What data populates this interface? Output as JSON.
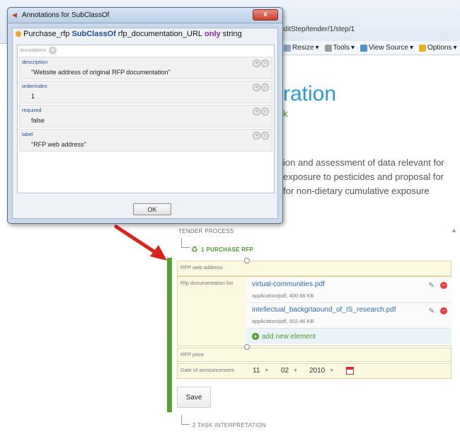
{
  "browser": {
    "url": "editStep/tender/1/step/1",
    "toolbar": [
      {
        "label": "Resize",
        "icon": "resize-icon",
        "arrow": "▾"
      },
      {
        "label": "Tools",
        "icon": "tools-icon",
        "arrow": "▾"
      },
      {
        "label": "View Source",
        "icon": "view-source-icon",
        "arrow": "▾"
      },
      {
        "label": "Options",
        "icon": "options-icon",
        "arrow": "▾"
      }
    ]
  },
  "page": {
    "heading": "ration",
    "subheading": "k",
    "description_lines": [
      "ion and assessment of data relevant for",
      "exposure to pesticides and proposal for",
      "for non-dietary cumulative exposure"
    ]
  },
  "form": {
    "section_title": "TENDER PROCESS",
    "step1_label": "1 PURCHASE RFP",
    "step2_label": "2 TASK INTERPRETATION",
    "rfp_web_address_label": "RFP web address",
    "rfp_documentation_list_label": "Rfp documentation list",
    "documents": [
      {
        "name": "virtual-communities.pdf",
        "meta": "application/pdf, 400.68 KB"
      },
      {
        "name": "intellectual_backgrtaound_of_IS_research.pdf",
        "meta": "application/pdf, 302.46 KB"
      }
    ],
    "add_new_element": "add new element",
    "rfp_price_label": "RFP price",
    "date_label": "Date of announcement",
    "date_day": "11",
    "date_month": "02",
    "date_year": "2010",
    "save_label": "Save"
  },
  "dialog": {
    "title": "Annotations for SubClassOf",
    "close_glyph": "x",
    "axiom": {
      "subject": "Purchase_rfp",
      "keyword": "SubClassOf",
      "property": "rfp_documentation_URL",
      "quantifier": "only",
      "range": "string"
    },
    "annotations_header": "Annotations",
    "annotations": [
      {
        "key": "description",
        "value": "\"Website address of original RFP documentation\""
      },
      {
        "key": "orderIndex",
        "value": "1"
      },
      {
        "key": "required",
        "value": "false"
      },
      {
        "key": "label",
        "value": "\"RFP web address\""
      }
    ],
    "ok_label": "OK"
  },
  "colors": {
    "accent_blue": "#2c9ad8",
    "green": "#5aa02c",
    "red_arrow": "#d9241c"
  }
}
